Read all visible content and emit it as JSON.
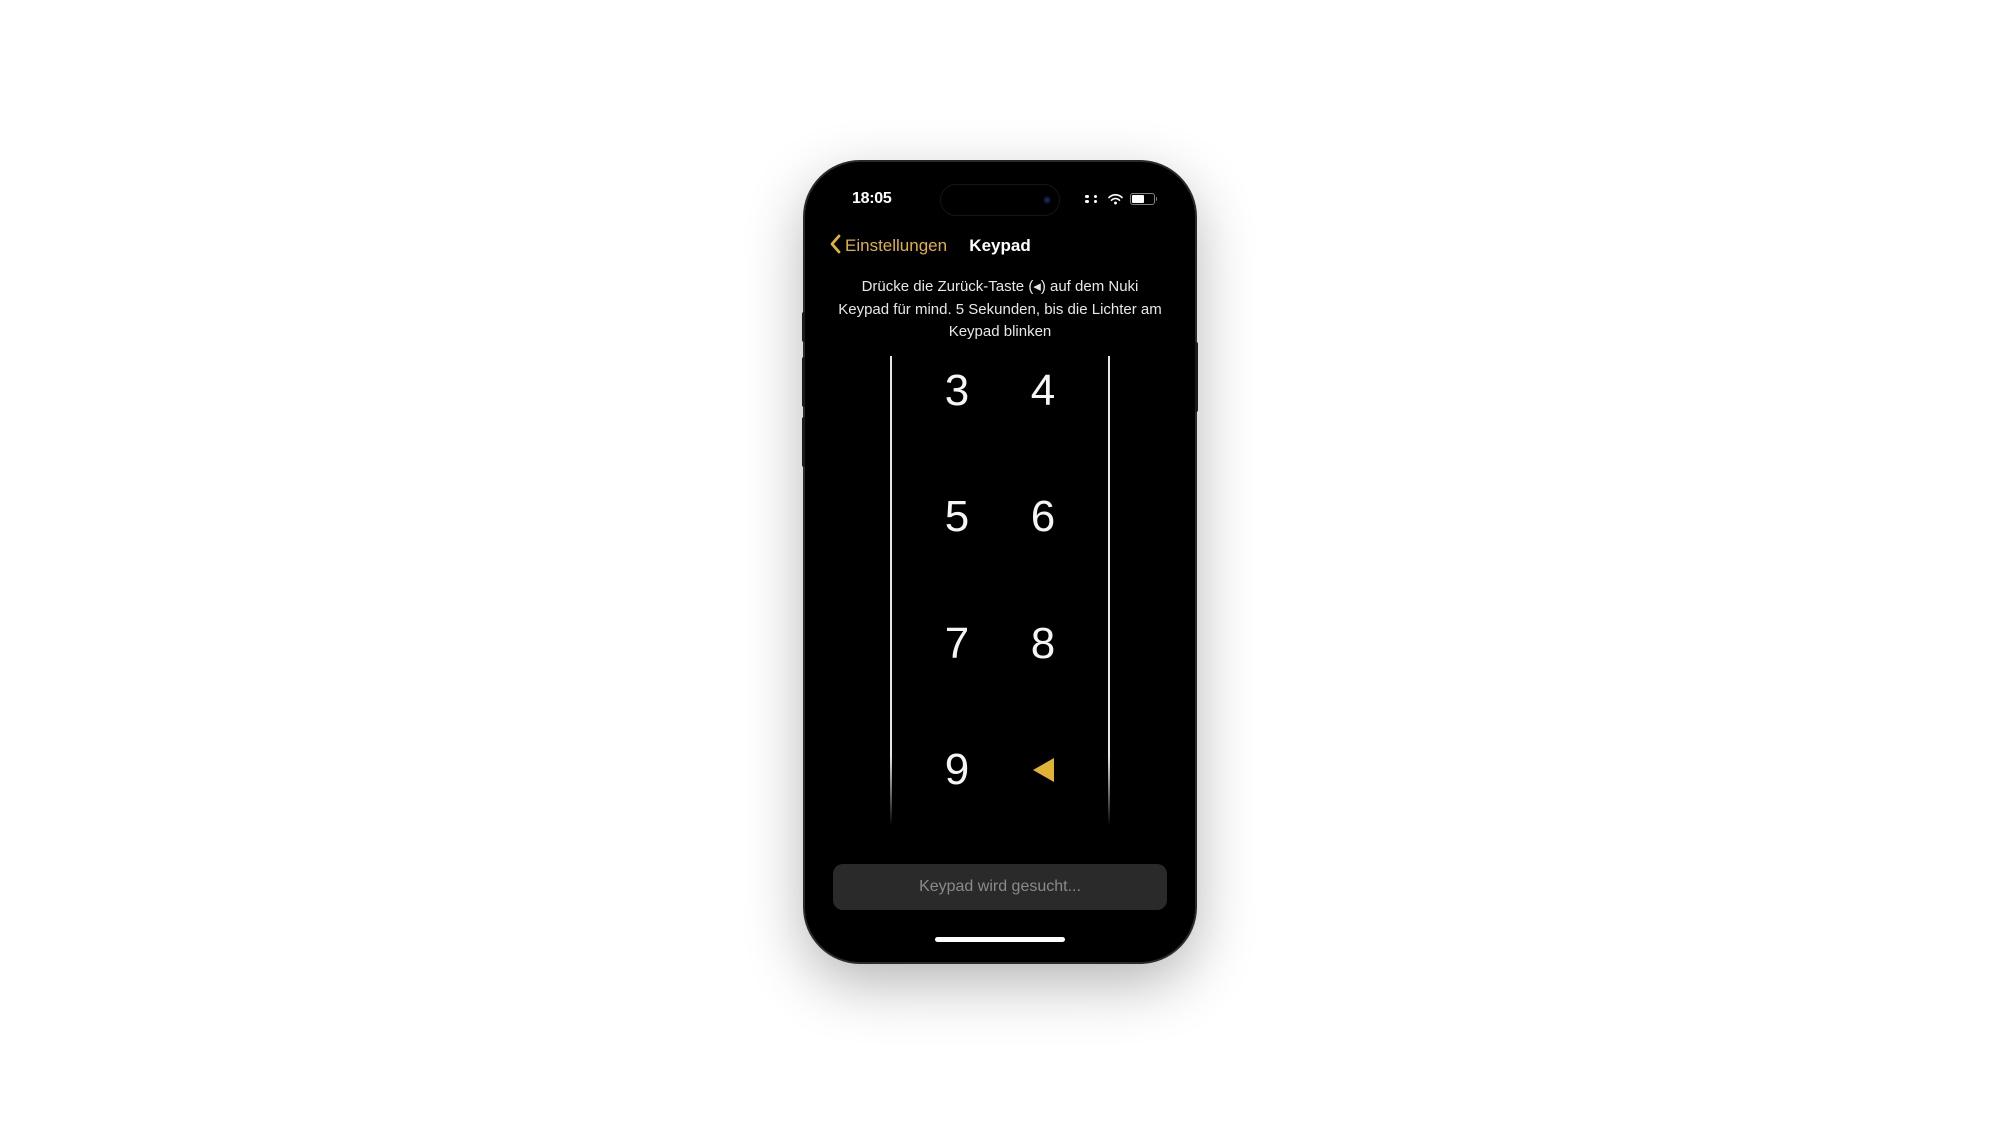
{
  "status_bar": {
    "time": "18:05"
  },
  "nav": {
    "back_label": "Einstellungen",
    "title": "Keypad"
  },
  "instruction": "Drücke die Zurück-Taste (◂) auf dem Nuki Keypad für mind. 5 Sekunden, bis die Lichter am Keypad blinken",
  "keypad": {
    "keys": [
      "3",
      "4",
      "5",
      "6",
      "7",
      "8",
      "9"
    ],
    "back_icon": "back-triangle"
  },
  "status_message": "Keypad wird gesucht...",
  "colors": {
    "accent": "#e0b432",
    "background": "#000000",
    "text_primary": "#ffffff",
    "text_muted": "#8a8a8a"
  }
}
